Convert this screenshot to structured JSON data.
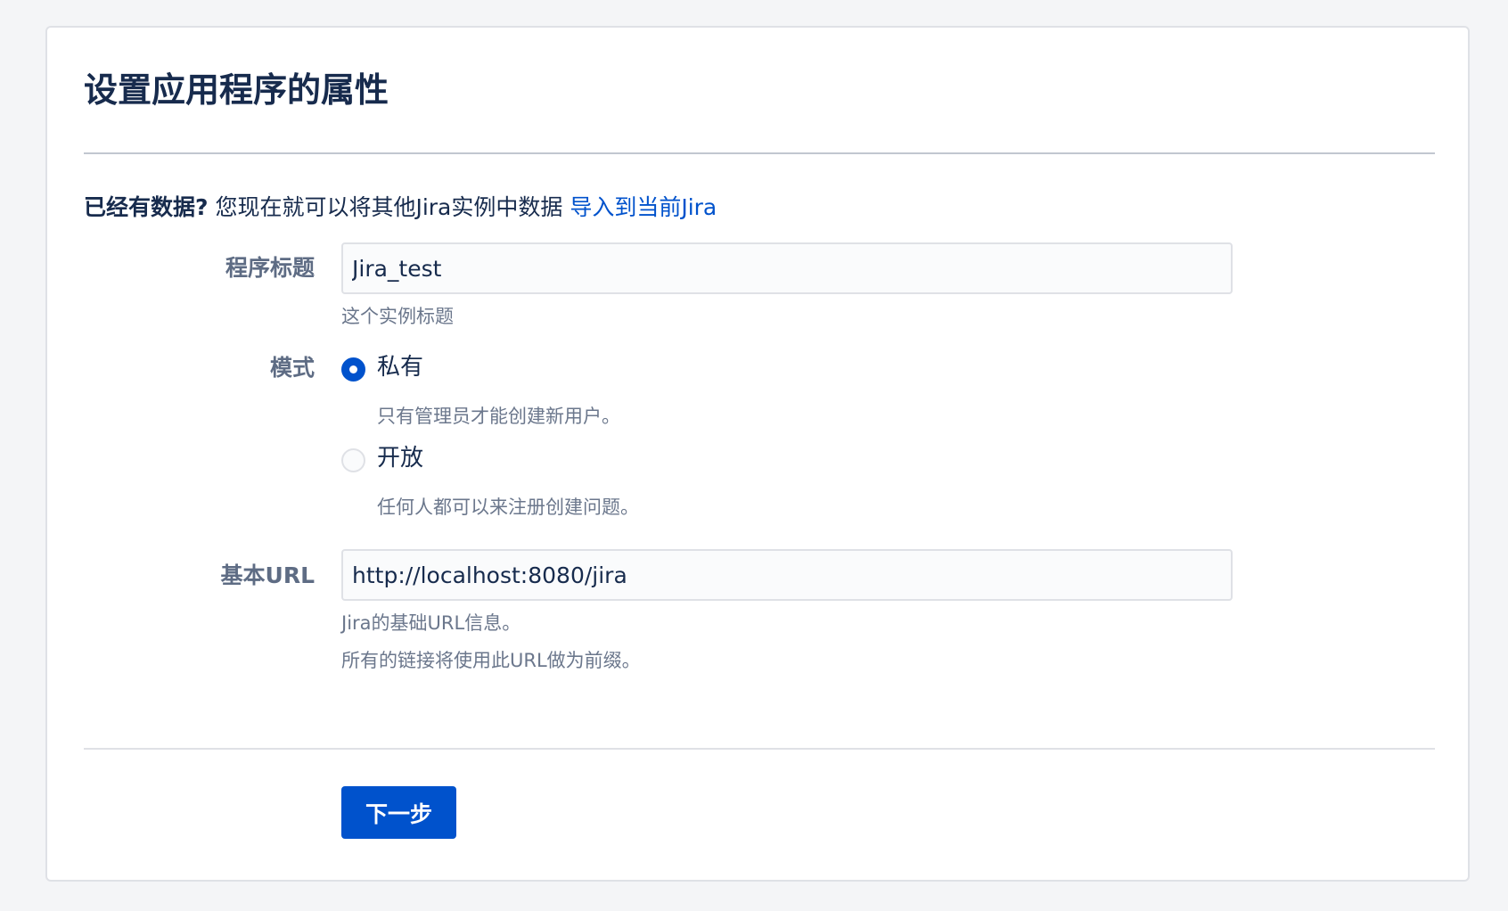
{
  "page": {
    "title": "设置应用程序的属性"
  },
  "import_notice": {
    "lead": "已经有数据?",
    "text": " 您现在就可以将其他Jira实例中数据 ",
    "link_label": "导入到当前Jira"
  },
  "fields": {
    "app_title": {
      "label": "程序标题",
      "value": "Jira_test",
      "help": "这个实例标题"
    },
    "mode": {
      "label": "模式",
      "selected": "private",
      "options": [
        {
          "id": "private",
          "label": "私有",
          "help": "只有管理员才能创建新用户。"
        },
        {
          "id": "public",
          "label": "开放",
          "help": "任何人都可以来注册创建问题。"
        }
      ]
    },
    "base_url": {
      "label": "基本URL",
      "value": "http://localhost:8080/jira",
      "help_lines": [
        "Jira的基础URL信息。",
        "所有的链接将使用此URL做为前缀。"
      ]
    }
  },
  "actions": {
    "next_label": "下一步"
  },
  "colors": {
    "accent": "#0052cc",
    "background": "#f4f5f7",
    "text": "#172b4d",
    "muted": "#6b778c"
  }
}
